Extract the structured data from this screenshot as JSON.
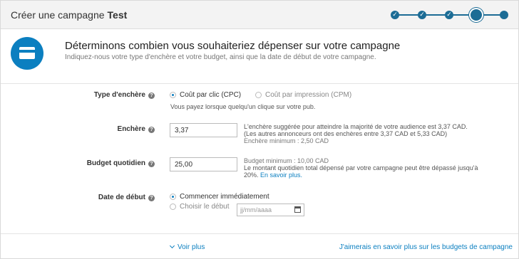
{
  "header": {
    "title": "Créer une campagne",
    "campaign_name": "Test",
    "steps": [
      {
        "state": "done",
        "symbol": "✓"
      },
      {
        "state": "done",
        "symbol": "✓"
      },
      {
        "state": "done",
        "symbol": "✓"
      },
      {
        "state": "current",
        "symbol": ""
      },
      {
        "state": "todo",
        "symbol": ""
      }
    ]
  },
  "intro": {
    "icon": "credit-card-icon",
    "title": "Déterminons combien vous souhaiteriez dépenser sur votre campagne",
    "subtitle": "Indiquez-nous votre type d'enchère et votre budget, ainsi que la date de début de votre campagne."
  },
  "form": {
    "bid_type": {
      "label": "Type d'enchère",
      "options": [
        {
          "label": "Coût par clic (CPC)",
          "selected": true
        },
        {
          "label": "Coût par impression (CPM)",
          "selected": false
        }
      ],
      "note": "Vous payez lorsque quelqu'un clique sur votre pub."
    },
    "bid": {
      "label": "Enchère",
      "value": "3,37",
      "note_line1": "L'enchère suggérée pour atteindre la majorité de votre audience est 3,37 CAD.",
      "note_line2": "(Les autres annonceurs ont des enchères entre 3,37 CAD et 5,33 CAD)",
      "note_line3": "Enchère minimum : 2,50 CAD"
    },
    "daily_budget": {
      "label": "Budget quotidien",
      "value": "25,00",
      "note_line1": "Budget minimum : 10,00 CAD",
      "note_line2": "Le montant quotidien total dépensé par votre campagne peut être dépassé jusqu'à",
      "note_line3": "20%.",
      "learn_more": "En savoir plus."
    },
    "start_date": {
      "label": "Date de début",
      "options": [
        {
          "label": "Commencer immédiatement",
          "selected": true
        },
        {
          "label": "Choisir le début",
          "selected": false
        }
      ],
      "date_placeholder": "jj/mm/aaaa"
    }
  },
  "footer": {
    "show_more": "Voir plus",
    "budget_link": "J'aimerais en savoir plus sur les budgets de campagne"
  },
  "colors": {
    "accent": "#0b7fc0",
    "progress": "#1c6c95"
  }
}
